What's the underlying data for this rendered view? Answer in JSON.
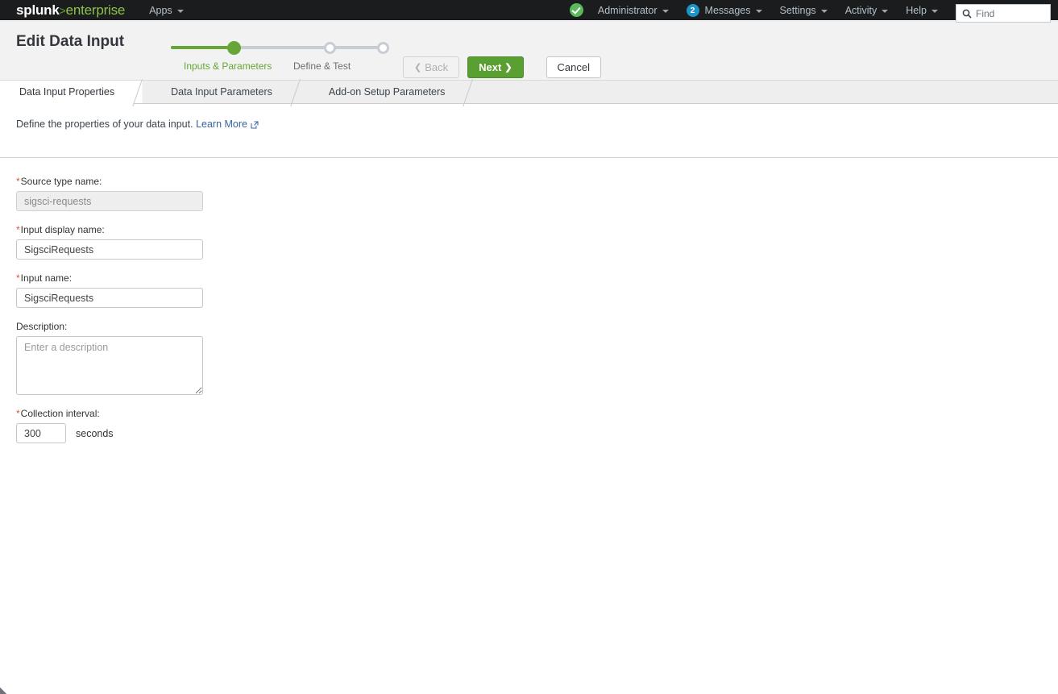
{
  "appbar": {
    "brand": {
      "name": "splunk",
      "separator": ">",
      "edition": "enterprise"
    },
    "apps_label": "Apps",
    "health_icon": "health-check-circle-icon",
    "user_label": "Administrator",
    "messages_count": "2",
    "messages_label": "Messages",
    "settings_label": "Settings",
    "activity_label": "Activity",
    "help_label": "Help",
    "find_placeholder": "Find",
    "find_value": "",
    "find_icon": "search-icon"
  },
  "header": {
    "title": "Edit Data Input",
    "stepper": {
      "steps": [
        {
          "label": "Inputs & Parameters",
          "state": "current"
        },
        {
          "label": "Define & Test",
          "state": "todo"
        },
        {
          "label": "",
          "state": "todo"
        }
      ]
    },
    "buttons": {
      "back": "Back",
      "back_disabled": true,
      "next": "Next",
      "cancel": "Cancel"
    },
    "accent_green": "#65a637",
    "track_grey": "#c6cdd4"
  },
  "tabs": [
    {
      "label": "Data Input Properties",
      "active": true
    },
    {
      "label": "Data Input Parameters",
      "active": false
    },
    {
      "label": "Add-on Setup Parameters",
      "active": false
    }
  ],
  "intro": {
    "text": "Define the properties of your data input.",
    "link_label": "Learn More",
    "link_icon": "external-link-icon"
  },
  "form": {
    "fields": [
      {
        "label": "Source type name:",
        "required": true,
        "value": "sigsci-requests",
        "placeholder": "",
        "disabled": true
      },
      {
        "label": "Input display name:",
        "required": true,
        "value": "SigsciRequests",
        "placeholder": "",
        "disabled": false
      },
      {
        "label": "Input name:",
        "required": true,
        "value": "SigsciRequests",
        "placeholder": "",
        "disabled": false
      }
    ],
    "description": {
      "label": "Description:",
      "required": false,
      "value": "",
      "placeholder": "Enter a description"
    },
    "interval": {
      "label": "Collection interval:",
      "required": true,
      "value": "300",
      "unit": "seconds"
    }
  }
}
